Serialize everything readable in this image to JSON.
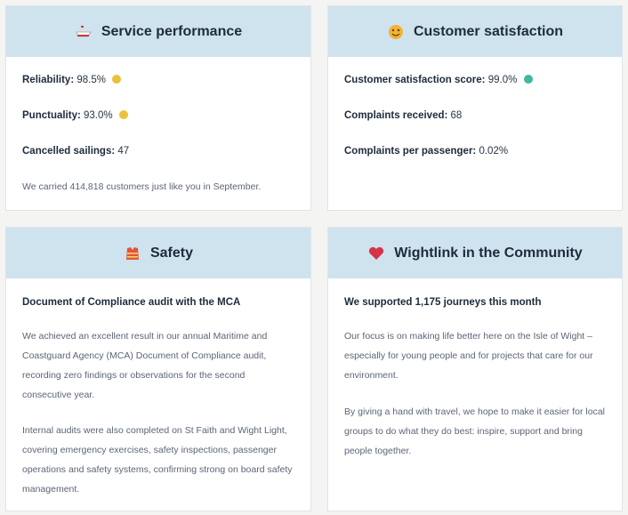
{
  "colors": {
    "header_bg": "#cfe3ee",
    "status_amber": "#e8c23a",
    "status_green": "#3fb8a0"
  },
  "service": {
    "title": "Service performance",
    "icon": "ferry-icon",
    "reliability_label": "Reliability:",
    "reliability_value": "98.5%",
    "punctuality_label": "Punctuality:",
    "punctuality_value": "93.0%",
    "cancelled_label": "Cancelled sailings:",
    "cancelled_value": "47",
    "carried_text": "We carried 414,818 customers just like you in September."
  },
  "satisfaction": {
    "title": "Customer satisfaction",
    "icon": "smiley-face-icon",
    "score_label": "Customer satisfaction score:",
    "score_value": "99.0%",
    "complaints_label": "Complaints received:",
    "complaints_value": "68",
    "per_passenger_label": "Complaints per passenger:",
    "per_passenger_value": "0.02%"
  },
  "safety": {
    "title": "Safety",
    "icon": "life-jacket-icon",
    "subhead": "Document of Compliance audit with the MCA",
    "para1": "We achieved an excellent result in our annual Maritime and Coastguard Agency (MCA) Document of Compliance audit, recording zero findings or observations for the second consecutive year.",
    "para2": "Internal audits were also completed on St Faith and Wight Light, covering emergency exercises, safety inspections, passenger operations and safety systems, confirming strong on board safety management."
  },
  "community": {
    "title": "Wightlink in the Community",
    "icon": "heart-icon",
    "subhead": "We supported 1,175 journeys this month",
    "para1": "Our focus is on making life better here on the Isle of Wight – especially for young people and for projects that care for our environment.",
    "para2": "By giving a hand with travel, we hope to make it easier for local groups to do what they do best: inspire, support and bring people together."
  }
}
